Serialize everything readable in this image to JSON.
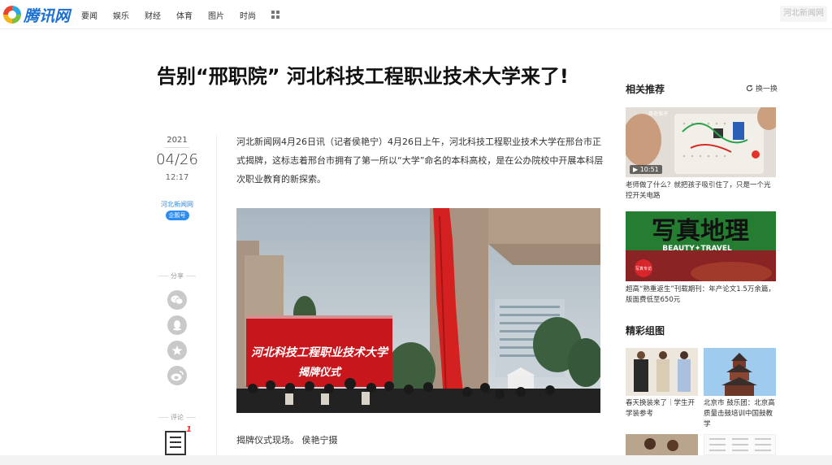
{
  "header": {
    "logo_text": "腾讯网",
    "nav": [
      "要闻",
      "娱乐",
      "财经",
      "体育",
      "图片",
      "时尚"
    ],
    "right_button": "河北新闻网"
  },
  "article": {
    "title": "告别“邢职院” 河北科技工程职业技术大学来了!",
    "date_year": "2021",
    "date_md": "04/26",
    "date_time": "12:17",
    "source": "河北新闻网",
    "source_badge": "企鹅号",
    "share_label": "分享",
    "comment_label": "评论",
    "comment_count": "1",
    "lead": "河北新闻网4月26日讯（记者侯艳宁）4月26日上午，河北科技工程职业技术大学在邢台市正式揭牌，这标志着邢台市拥有了第一所以“大学”命名的本科高校，是在公办院校中开展本科层次职业教育的新探索。",
    "photo_banner_line1": "河北科技工程职业技术大学",
    "photo_banner_line2": "揭牌仪式",
    "caption": "揭牌仪式现场。 侯艳宁摄"
  },
  "sidebar": {
    "related_title": "相关推荐",
    "refresh_label": "换一换",
    "items": [
      {
        "video_duration": "10:51",
        "thumb_tag": "奇奇骆子",
        "text": "老师做了什么？就把孩子吸引住了，只是一个光控开关电路"
      },
      {
        "thumb_title": "写真地理",
        "thumb_sub": "BEAUTY✦TRAVEL",
        "thumb_badge": "写真专访",
        "text": "超高“熟重返生”刊载期刊：年产论文1.5万余篇，版面费低至650元"
      }
    ],
    "gallery_title": "精彩组图",
    "gallery": [
      {
        "text": "春天换装来了｜学生开学装参考"
      },
      {
        "text": "北京市 鼓乐团：北京高质量击鼓培训中国鼓教学"
      }
    ]
  },
  "colors": {
    "brand": "#1a6fd1",
    "source_link": "#3a8ad8",
    "badge": "#2d8cf0"
  }
}
